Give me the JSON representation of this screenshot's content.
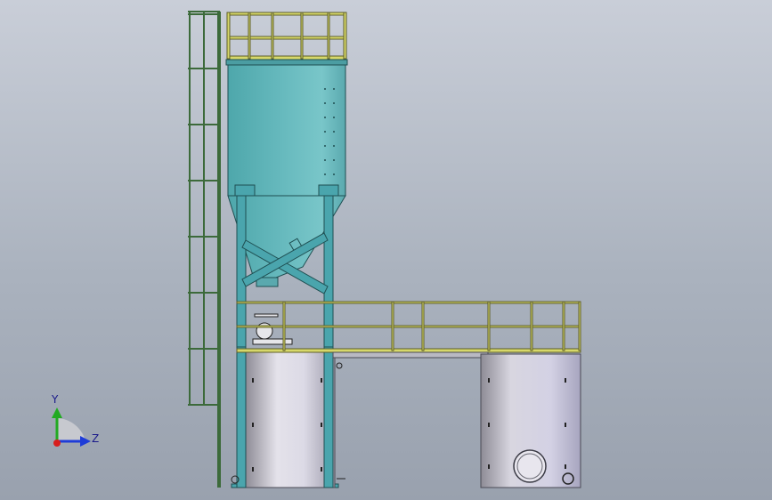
{
  "triad": {
    "y_label": "Y",
    "z_label": "Z",
    "colors": {
      "y": "#22aa22",
      "z": "#1e3cd8",
      "x": "#d81e1e"
    }
  },
  "colors": {
    "silo_body": "#5fb4b8",
    "steel": "#4aa5ad",
    "railing": "#d7d86a",
    "tank": "#c9c7d2",
    "ladder": "#3c6a3a"
  }
}
